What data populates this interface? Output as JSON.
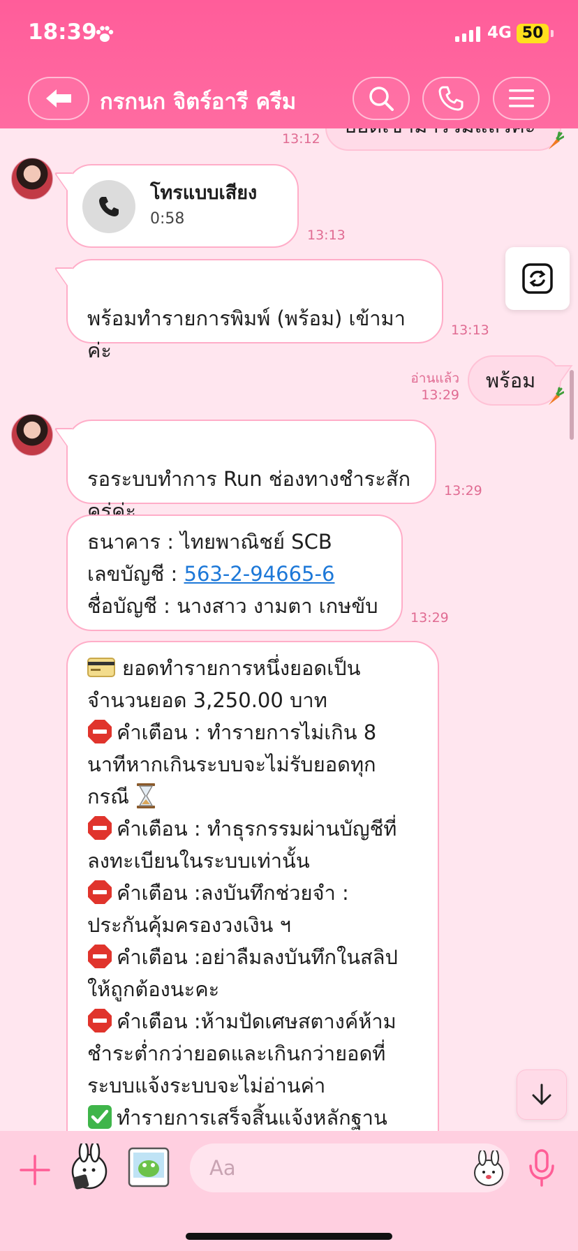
{
  "status": {
    "time": "18:39",
    "network": "4G",
    "battery": "50"
  },
  "header": {
    "title": "กรกนก จิตร์อารี ครีม"
  },
  "messages": {
    "m0": {
      "text": "ยอดเข้ามาร่วมแล้วค่ะ",
      "time": "13:12"
    },
    "m1": {
      "title": "โทรแบบเสียง",
      "duration": "0:58",
      "time": "13:13"
    },
    "m2": {
      "text": "พร้อมทำรายการพิมพ์  (พร้อม) เข้ามา\nค่ะ",
      "time": "13:13"
    },
    "m3": {
      "text": "พร้อม",
      "read": "อ่านแล้ว",
      "time": "13:29"
    },
    "m4": {
      "text": "รอระบบทำการ Run ช่องทางชำระสัก\nครู่ค่ะ",
      "time": "13:29"
    },
    "m5": {
      "bank_line": "ธนาคาร  :  ไทยพาณิชย์ SCB",
      "acct_label": "เลขบัญชี : ",
      "acct_no": "563-2-94665-6",
      "name_line": "ชื่อบัญชี : นางสาว งามตา เกษขับ",
      "time": "13:29"
    },
    "m6": {
      "l1": "ยอดทำรายการหนึ่งยอดเป็น\nจำนวนยอด  3,250.00 บาท",
      "l2": "คำเตือน : ทำรายการไม่เกิน 8\nนาทีหากเกินระบบจะไม่รับยอดทุก\nกรณี",
      "l3": "คำเตือน : ทำธุรกรรมผ่านบัญชีที่\nลงทะเบียนในระบบเท่านั้น",
      "l4": "คำเตือน :ลงบันทึกช่วยจำ  :\nประกันคุ้มครองวงเงิน ฯ",
      "l5": "คำเตือน :อย่าลืมลงบันทึกในสลิป\nให้ถูกต้องนะคะ",
      "l6": "คำเตือน :ห้ามปัดเศษสตางค์ห้าม\nชำระต่ำกว่ายอดและเกินกว่ายอดที่\nระบบแจ้งระบบจะไม่อ่านค่า",
      "l7": "ทำรายการเสร็จสิ้นแจ้งหลักฐาน"
    }
  },
  "input": {
    "placeholder": "Aa"
  },
  "colors": {
    "header": "#ff62a0",
    "bubble_border": "#ffadc8",
    "time": "#e06b92",
    "link": "#1d78d8"
  },
  "icons": [
    "back-arrow-icon",
    "search-icon",
    "phone-icon",
    "menu-icon",
    "paw-icon",
    "refresh-icon",
    "arrow-down-icon",
    "plus-icon",
    "sticker-icon",
    "image-icon",
    "mic-icon",
    "carrot-icon",
    "stop-sign-icon",
    "hourglass-icon",
    "check-icon",
    "credit-card-icon"
  ]
}
